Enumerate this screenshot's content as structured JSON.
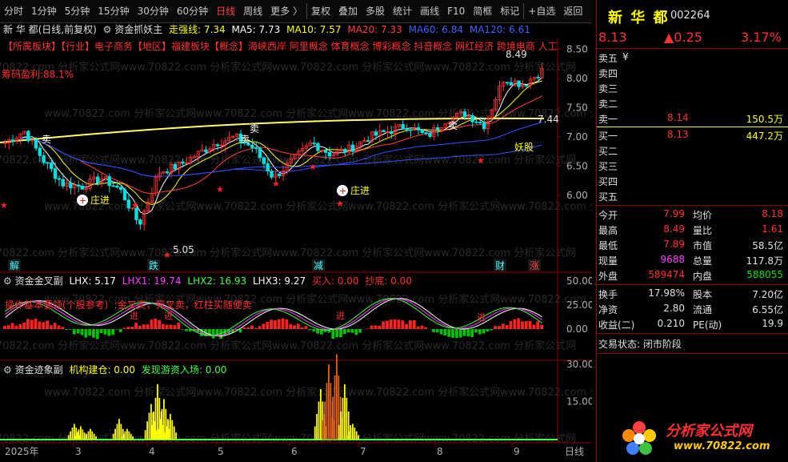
{
  "toolbar": {
    "items": [
      "分时",
      "1分钟",
      "5分钟",
      "15分钟",
      "30分钟",
      "60分钟",
      "日线",
      "周线",
      "更多 〉",
      "复权",
      "叠加",
      "多股",
      "统计",
      "画线",
      "F10",
      "简框",
      "标记",
      "+自选",
      "返回"
    ],
    "selected": "日线"
  },
  "main": {
    "stock_title": "新 华 都(日线,前复权)",
    "indicator_name": "资金抓妖主",
    "main_line": "走强线: 7.34",
    "ma5": "MA5: 7.73",
    "ma10": "MA10: 7.57",
    "ma20": "MA20: 7.33",
    "ma60": "MA60: 6.84",
    "ma120": "MA120: 6.61",
    "tags": "【所属板块】【行业】电子商务【地区】福建板块【概念】海峡西岸 阿里概念 体育概念 博彩概念 抖音概念 网红经济 跨境电商 人工",
    "chip_profit": "筹码盈利:88.1%",
    "high_label": "8.49",
    "low_label": "5.05",
    "price_axis": [
      "8.50",
      "8.00",
      "7.50",
      "7.00",
      "6.50",
      "6.00"
    ],
    "current_price_tag": "7.44",
    "signal_sell": "卖",
    "signal_enter": "庄进",
    "signal_demon": "妖股",
    "bottom_labels": [
      {
        "text": "解",
        "color": "#40ffff"
      },
      {
        "text": "跌",
        "color": "#40ffff"
      },
      {
        "text": "减",
        "color": "#40ffff"
      },
      {
        "text": "财",
        "color": "#40ffff"
      },
      {
        "text": "涨",
        "color": "#ff4040"
      }
    ]
  },
  "sub1": {
    "name": "资金金叉副",
    "lhx": "LHX: 5.17",
    "lhx1": "LHX1: 19.74",
    "lhx2": "LHX2: 16.93",
    "lhx3": "LHX3: 9.27",
    "buy": "买入: 0.00",
    "chaodi": "抄底: 0.00",
    "note": "操作基本要领(个股参考）:金叉买，死叉卖，红柱买随便卖",
    "axis": [
      "50.00",
      "25.00",
      "0.00"
    ],
    "marker": "进"
  },
  "sub2": {
    "name": "资金迹象副",
    "jigou": "机构建仓: 0.00",
    "youzi": "发现游资入场: 0.00",
    "axis": [
      "30.00",
      "15.00"
    ]
  },
  "xaxis": {
    "labels": [
      "2025年",
      "3",
      "4",
      "5",
      "6",
      "7",
      "8",
      "9"
    ],
    "period": "日线"
  },
  "quote": {
    "name": "新 华 都",
    "code": "002264",
    "price": "8.13",
    "change": "▲0.25",
    "pct": "3.17%",
    "unit_label": "¥",
    "asks": [
      {
        "label": "卖五",
        "price": "",
        "vol": ""
      },
      {
        "label": "卖四",
        "price": "",
        "vol": ""
      },
      {
        "label": "卖三",
        "price": "",
        "vol": ""
      },
      {
        "label": "卖二",
        "price": "",
        "vol": ""
      },
      {
        "label": "卖一",
        "price": "8.14",
        "vol": "150.5万"
      }
    ],
    "bids": [
      {
        "label": "买一",
        "price": "8.13",
        "vol": "447.2万"
      },
      {
        "label": "买二",
        "price": "",
        "vol": ""
      },
      {
        "label": "买三",
        "price": "",
        "vol": ""
      },
      {
        "label": "买四",
        "price": "",
        "vol": ""
      },
      {
        "label": "买五",
        "price": "",
        "vol": ""
      }
    ],
    "stats": [
      {
        "l1": "今开",
        "v1": "7.99",
        "c1": "red",
        "l2": "均价",
        "v2": "8.18",
        "c2": "red"
      },
      {
        "l1": "最高",
        "v1": "8.49",
        "c1": "red",
        "l2": "量比",
        "v2": "1.61",
        "c2": "red"
      },
      {
        "l1": "最低",
        "v1": "7.89",
        "c1": "red",
        "l2": "市值",
        "v2": "58.5亿",
        "c2": "wht"
      },
      {
        "l1": "现量",
        "v1": "9688",
        "c1": "mag",
        "l2": "总量",
        "v2": "117.8万",
        "c2": "wht"
      },
      {
        "l1": "外盘",
        "v1": "589474",
        "c1": "red",
        "l2": "内盘",
        "v2": "588055",
        "c2": "grn"
      }
    ],
    "fin": [
      {
        "l1": "换手",
        "v1": "17.98%",
        "l2": "股本",
        "v2": "7.20亿"
      },
      {
        "l1": "净资",
        "v1": "2.80",
        "l2": "流通",
        "v2": "6.55亿"
      },
      {
        "l1": "收益(二)",
        "v1": "0.210",
        "l2": "PE(动)",
        "v2": "19.9"
      }
    ],
    "status": "交易状态: 闭市阶段"
  },
  "watermark": "分析家公式网",
  "watermark_url": "www.70822.com",
  "logo_text": "分析家公式网",
  "logo_url": "www.70822.com"
}
